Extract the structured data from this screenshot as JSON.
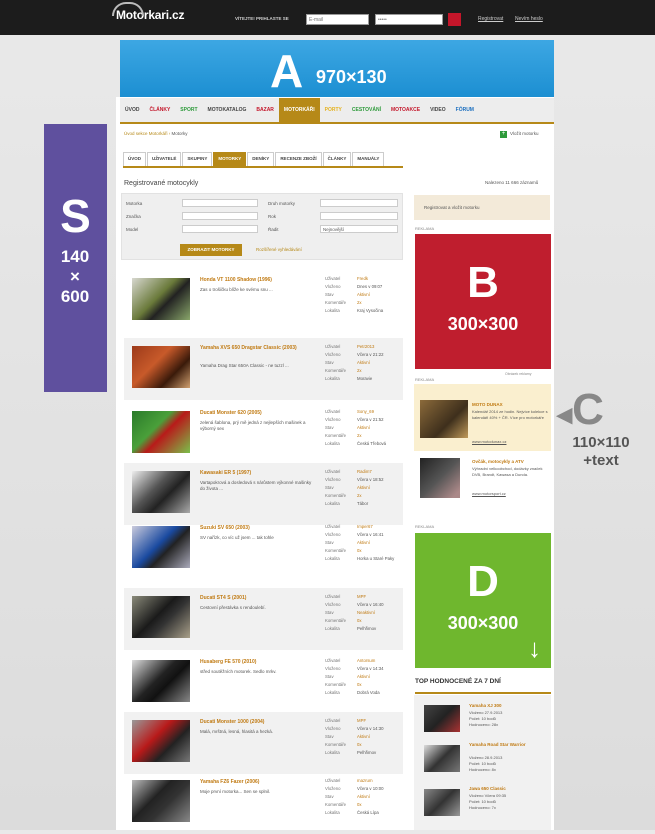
{
  "header": {
    "logo": "Motorkari.cz",
    "login_label": "VÍTEJTE! PRIHLASTE SE",
    "email_placeholder": "E-mail",
    "password_value": "•••••",
    "register": "Registrovat",
    "forgot": "Nevím heslo"
  },
  "banners": {
    "a_letter": "A",
    "a_size": "970×130",
    "s_letter": "S",
    "s_size": "140 × 600",
    "b_letter": "B",
    "b_size": "300×300",
    "c_letter": "C",
    "c_size": "110×110 +text",
    "d_letter": "D",
    "d_size": "300×300"
  },
  "nav": [
    "ÚVOD",
    "ČLÁNKY",
    "SPORT",
    "MOTOKATALOG",
    "BAZAR",
    "MOTORKÁŘI",
    "PORTY",
    "CESTOVÁNÍ",
    "MOTOAKCE",
    "VIDEO",
    "FÓRUM"
  ],
  "breadcrumb": {
    "link": "Úvod sekce Motorkáři",
    "current": "Motorky"
  },
  "add_moto": "Vložit motorku",
  "subtabs": [
    "ÚVOD",
    "UŽIVATELÉ",
    "SKUPINY",
    "MOTORKY",
    "DENÍKY",
    "RECENZE ZBOŽÍ",
    "ČLÁNKY",
    "MANUÁLY"
  ],
  "section_title": "Registrované motocykly",
  "count": "Nalezeno 11 666 záznamů",
  "filter": {
    "l1": "Motorka",
    "l2": "Značka",
    "l3": "Model",
    "l4": "Druh motorky",
    "l5": "Rok",
    "l6": "Řadit",
    "sort_value": "Nejnovější",
    "button": "ZOBRAZIT MOTORKY",
    "advanced": "Rozšířené vyhledávání"
  },
  "meta_labels": [
    "Uživatel",
    "Vloženo",
    "Stav",
    "Komentáře",
    "Lokalita"
  ],
  "listings": [
    {
      "title": "Honda VT 1100 Shadow (1996)",
      "desc": "Zas o trošičku blíže ke svému snu ...",
      "user": "Fredk",
      "date": "Dnes v 09:07",
      "state": "Aktivní",
      "comments": "2x",
      "loc": "Kraj Vysočina"
    },
    {
      "title": "Yamaha XVS 650 Dragstar Classic (2003)",
      "desc": "Yamaha Drag Star 650A Classic - ne tuzzl ...",
      "user": "Petr2013",
      "date": "Včera v 21:22",
      "state": "Aktivní",
      "comments": "2x",
      "loc": "Moravie"
    },
    {
      "title": "Ducati Monster 620 (2005)",
      "desc": "zelená šablona, prý mě jedná z nejlepších mašinek a výborný sex",
      "user": "Sony_69",
      "date": "Včera v 21:52",
      "state": "Aktivní",
      "comments": "2x",
      "loc": "Česká Třebová"
    },
    {
      "title": "Kawasaki ER 5 (1997)",
      "desc": "Vartapokrová a dosledová s nárůstem výkonné mašinky do života ...",
      "user": "Radim7",
      "date": "Včera v 18:52",
      "state": "Aktivní",
      "comments": "2x",
      "loc": "Tábor"
    },
    {
      "title": "Suzuki SV 650 (2003)",
      "desc": "SV nařízk, co víc už jsem ... tak tohle",
      "user": "Imper67",
      "date": "Včera v 16:41",
      "state": "Aktivní",
      "comments": "0x",
      "loc": "Horka u Staré Paky"
    },
    {
      "title": "Ducati ST4 S (2001)",
      "desc": "Cestovní přestávka s rendoulebí.",
      "user": "MPF",
      "date": "Včera v 16:40",
      "state": "Neaktivní",
      "comments": "0x",
      "loc": "Pelhřimov"
    },
    {
      "title": "Husaberg FE 570 (2010)",
      "desc": "střed soutěžních motorek. Sedlo mrkv.",
      "user": "Antorsum",
      "date": "Včera v 14:34",
      "state": "Aktivní",
      "comments": "0x",
      "loc": "Dobrá Voda"
    },
    {
      "title": "Ducati Monster 1000 (2004)",
      "desc": "Malá, mrštná, lesná, hlasitá a hezká.",
      "user": "MPF",
      "date": "Včera v 14:30",
      "state": "Aktivní",
      "comments": "0x",
      "loc": "Pelhřimov"
    },
    {
      "title": "Yamaha FZ6 Fazer (2006)",
      "desc": "Moje první motorka... Sen se splnil.",
      "user": "mazrum",
      "date": "Včera v 10:00",
      "state": "Aktivní",
      "comments": "0x",
      "loc": "Česká Lípa"
    }
  ],
  "sidebar": {
    "fav": "Registrovat a vložit motorku",
    "ad_label": "REKLAMA",
    "img_caption": "Obrázek reklamy",
    "c1_title": "MOTO DUNAX",
    "c1_text": "Kalendář 2014 ze hodin. Nejvíce kolekce s kalendáři 40% + ČR. Více pro motorkáře",
    "c1_link": "www.motodunax.cz",
    "c2_title": "Ovčák, motocykly a ATV",
    "c2_text": "Výhradní velkoobchod, dodávky značek DVB, Brandt, Kawasa a Dunda.",
    "c2_link": "www.motorsport.cz",
    "top_title": "TOP HODNOCENÉ ZA 7 DNÍ",
    "top": [
      {
        "title": "Yamaha XJ 300",
        "m1": "Vloženo 27.9.2013",
        "m2": "Počet: 10 bodů",
        "m3": "Hodnoceno: 28x"
      },
      {
        "title": "Yamaha Road Star Warrior",
        "m1": "Vloženo 28.9.2013",
        "m2": "Počet: 10 bodů",
        "m3": "Hodnoceno: 8x"
      },
      {
        "title": "Jawa 650 Classic",
        "m1": "Vloženo Včera 09:35",
        "m2": "Počet: 10 bodů",
        "m3": "Hodnoceno: 7x"
      }
    ]
  },
  "colors": {
    "accent": "#b68918",
    "banner_a": "#2b9ad9",
    "banner_s": "#5f509e",
    "banner_b": "#bf1e2e",
    "banner_d": "#6fb72e"
  }
}
